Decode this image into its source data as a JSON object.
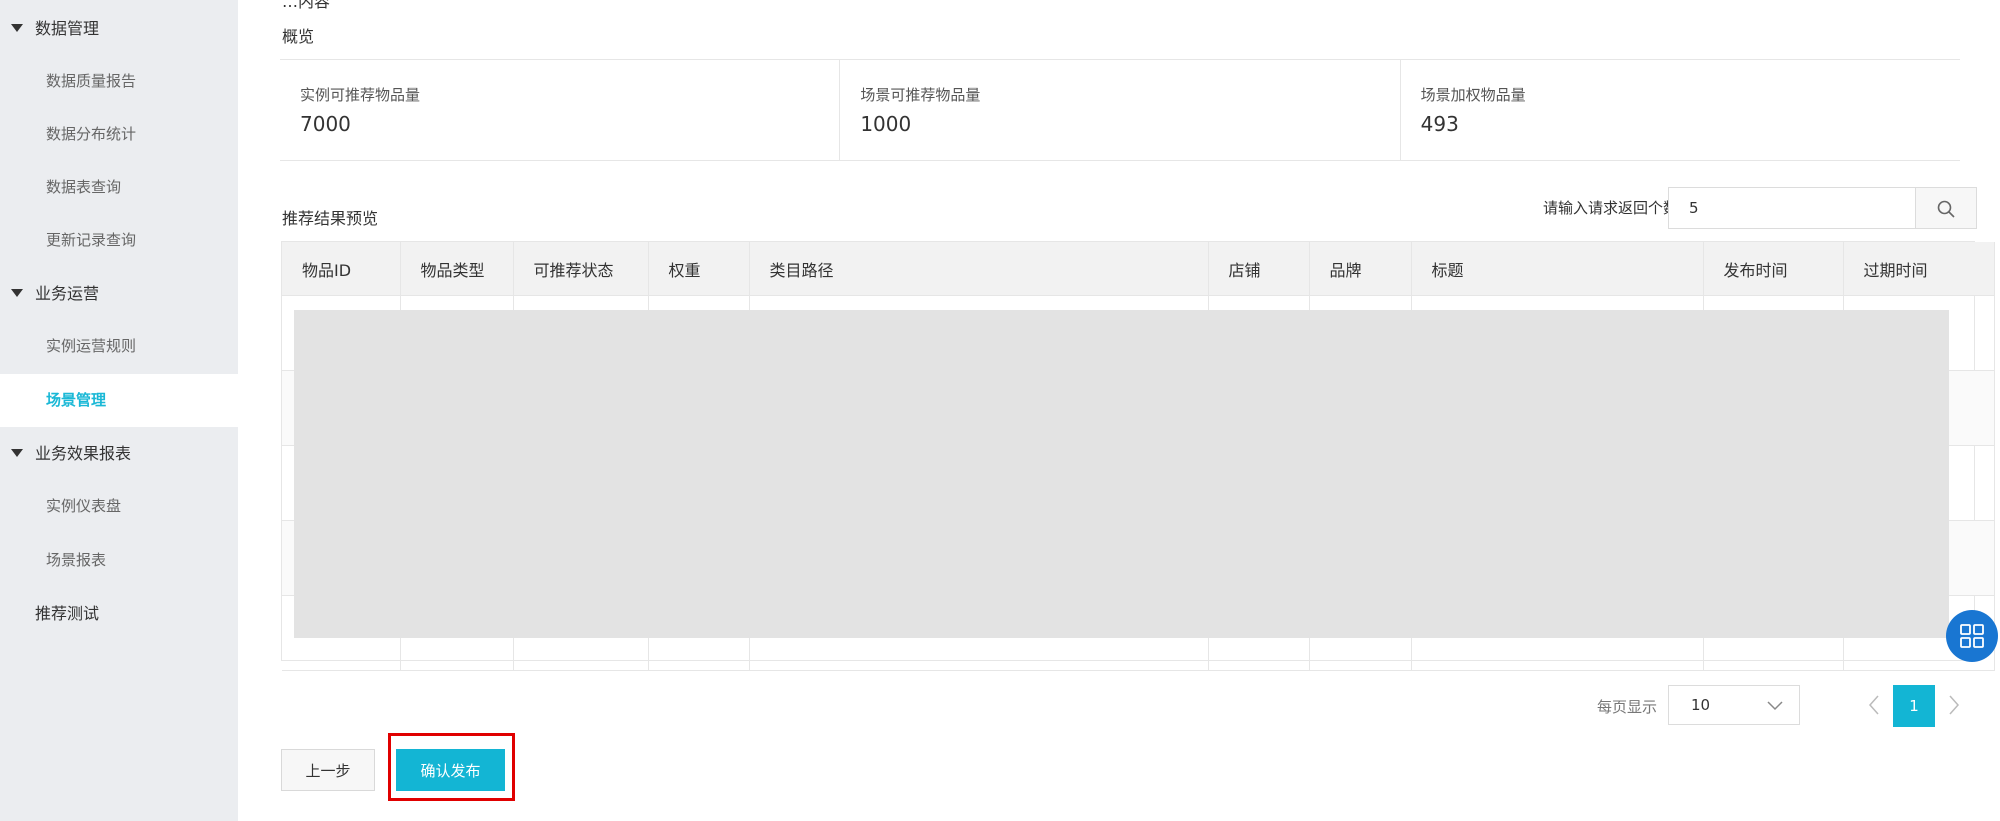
{
  "sidebar": {
    "groups": [
      {
        "label": "数据管理",
        "items": [
          "数据质量报告",
          "数据分布统计",
          "数据表查询",
          "更新记录查询"
        ]
      },
      {
        "label": "业务运营",
        "items": [
          "实例运营规则",
          "场景管理"
        ]
      },
      {
        "label": "业务效果报表",
        "items": [
          "实例仪表盘",
          "场景报表"
        ]
      }
    ],
    "standalone": "推荐测试",
    "active": "场景管理"
  },
  "main": {
    "top_cut_text": "…内容",
    "overview": {
      "title": "概览",
      "stats": [
        {
          "label": "实例可推荐物品量",
          "value": "7000"
        },
        {
          "label": "场景可推荐物品量",
          "value": "1000"
        },
        {
          "label": "场景加权物品量",
          "value": "493"
        }
      ]
    },
    "preview": {
      "title": "推荐结果预览",
      "request_label": "请输入请求返回个数:",
      "request_value": "5",
      "columns": [
        "物品ID",
        "物品类型",
        "可推荐状态",
        "权重",
        "类目路径",
        "店铺",
        "品牌",
        "标题",
        "发布时间",
        "过期时间"
      ]
    },
    "pagination": {
      "per_page_label": "每页显示",
      "per_page_value": "10",
      "current_page": "1"
    },
    "actions": {
      "prev_label": "上一步",
      "confirm_label": "确认发布"
    }
  },
  "colors": {
    "accent": "#13b5d4",
    "highlight_frame": "#e00000",
    "floating_button": "#1976d2"
  }
}
